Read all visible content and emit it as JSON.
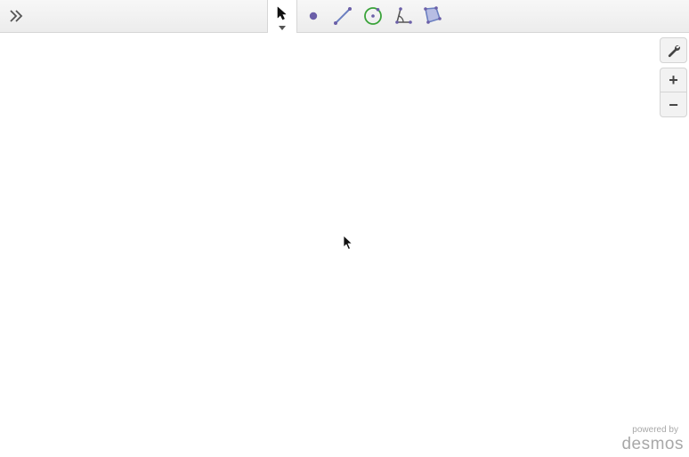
{
  "toolbar": {
    "tools": [
      {
        "id": "select",
        "icon": "arrow-cursor-icon",
        "selected": true
      },
      {
        "id": "point",
        "icon": "point-icon"
      },
      {
        "id": "segment",
        "icon": "segment-icon"
      },
      {
        "id": "circle",
        "icon": "circle-icon"
      },
      {
        "id": "angle",
        "icon": "angle-icon"
      },
      {
        "id": "polygon",
        "icon": "polygon-icon"
      }
    ],
    "expand_icon": "double-chevron-right-icon"
  },
  "side_controls": {
    "settings_icon": "wrench-icon",
    "zoom_in_label": "+",
    "zoom_out_label": "−"
  },
  "branding": {
    "powered_by": "powered by",
    "name": "desmos"
  },
  "colors": {
    "accent_purple": "#6b5fa8",
    "accent_green": "#3aa33a",
    "toolbar_bg": "#ececec"
  }
}
